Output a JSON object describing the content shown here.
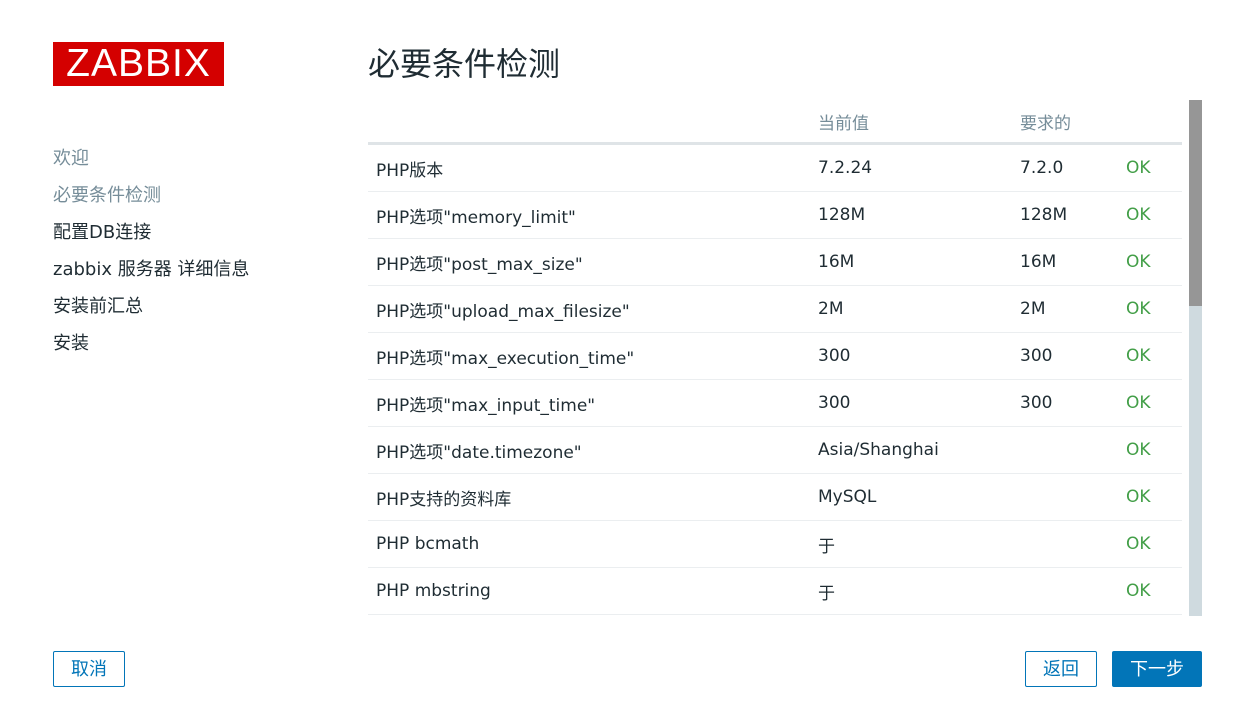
{
  "logo": {
    "text": "ZABBIX"
  },
  "title": "必要条件检测",
  "steps": [
    {
      "label": "欢迎",
      "state": "done"
    },
    {
      "label": "必要条件检测",
      "state": "current"
    },
    {
      "label": "配置DB连接",
      "state": "pending"
    },
    {
      "label": "zabbix 服务器 详细信息",
      "state": "pending"
    },
    {
      "label": "安装前汇总",
      "state": "pending"
    },
    {
      "label": "安装",
      "state": "pending"
    }
  ],
  "table": {
    "headers": {
      "name": "",
      "current": "当前值",
      "required": "要求的",
      "status": ""
    },
    "rows": [
      {
        "name": "PHP版本",
        "current": "7.2.24",
        "required": "7.2.0",
        "status": "OK"
      },
      {
        "name": "PHP选项\"memory_limit\"",
        "current": "128M",
        "required": "128M",
        "status": "OK"
      },
      {
        "name": "PHP选项\"post_max_size\"",
        "current": "16M",
        "required": "16M",
        "status": "OK"
      },
      {
        "name": "PHP选项\"upload_max_filesize\"",
        "current": "2M",
        "required": "2M",
        "status": "OK"
      },
      {
        "name": "PHP选项\"max_execution_time\"",
        "current": "300",
        "required": "300",
        "status": "OK"
      },
      {
        "name": "PHP选项\"max_input_time\"",
        "current": "300",
        "required": "300",
        "status": "OK"
      },
      {
        "name": "PHP选项\"date.timezone\"",
        "current": "Asia/Shanghai",
        "required": "",
        "status": "OK"
      },
      {
        "name": "PHP支持的资料库",
        "current": "MySQL",
        "required": "",
        "status": "OK"
      },
      {
        "name": "PHP bcmath",
        "current": "于",
        "required": "",
        "status": "OK"
      },
      {
        "name": "PHP mbstring",
        "current": "于",
        "required": "",
        "status": "OK"
      }
    ]
  },
  "buttons": {
    "cancel": "取消",
    "back": "返回",
    "next": "下一步"
  },
  "colors": {
    "brand": "#d40000",
    "accent": "#0275b8",
    "ok": "#429e47",
    "muted": "#768d99"
  }
}
